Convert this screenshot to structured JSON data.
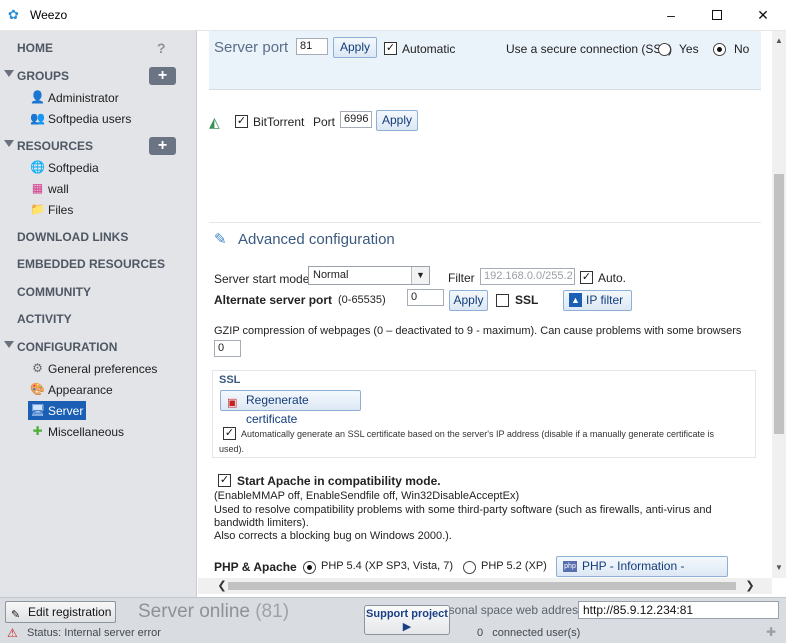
{
  "window": {
    "app_icon": "weezo-logo",
    "title": "Weezo",
    "min_glyph": "–",
    "close_glyph": "✕"
  },
  "sidebar": {
    "home": "HOME",
    "help_glyph": "?",
    "groups": {
      "label": "GROUPS",
      "add_glyph": "+",
      "items": [
        {
          "label": "Administrator",
          "icon": "admin-user-icon"
        },
        {
          "label": "Softpedia users",
          "icon": "user-group-icon"
        }
      ]
    },
    "resources": {
      "label": "RESOURCES",
      "add_glyph": "+",
      "items": [
        {
          "label": "Softpedia",
          "icon": "web-resource-icon"
        },
        {
          "label": "wall",
          "icon": "wall-icon"
        },
        {
          "label": "Files",
          "icon": "folder-icon"
        }
      ]
    },
    "download_links": "DOWNLOAD LINKS",
    "embedded_resources": "EMBEDDED RESOURCES",
    "community": "COMMUNITY",
    "activity": "ACTIVITY",
    "configuration": {
      "label": "CONFIGURATION",
      "items": [
        {
          "label": "General preferences",
          "icon": "preferences-icon"
        },
        {
          "label": "Appearance",
          "icon": "palette-icon"
        },
        {
          "label": "Server",
          "icon": "monitor-icon",
          "selected": true
        },
        {
          "label": "Miscellaneous",
          "icon": "puzzle-icon"
        }
      ]
    }
  },
  "server": {
    "port_label": "Server port",
    "port_value": "81",
    "apply": "Apply",
    "automatic_label": "Automatic",
    "automatic_checked": true,
    "ssl_question": "Use a secure connection (SSL)",
    "yes": "Yes",
    "no": "No",
    "ssl_selected": "No"
  },
  "bittorrent": {
    "label": "BitTorrent",
    "checked": true,
    "port_label": "Port",
    "port_value": "6996",
    "apply": "Apply"
  },
  "advanced": {
    "title": "Advanced configuration",
    "start_mode_label": "Server start mode",
    "start_mode_value": "Normal",
    "filter_label": "Filter",
    "filter_value": "192.168.0.0/255.2",
    "auto_label": "Auto.",
    "auto_checked": true,
    "alt_port_label": "Alternate server port",
    "alt_port_range": "(0-65535)",
    "alt_port_value": "0",
    "apply": "Apply",
    "ssl_label": "SSL",
    "ssl_checked": false,
    "ip_filter": "IP filter",
    "gzip_label": "GZIP compression of webpages (0 – deactivated to 9 - maximum). Can cause problems with some browsers",
    "gzip_value": "0"
  },
  "ssl_section": {
    "title": "SSL",
    "regen_button": "Regenerate certificate",
    "auto_gen_line1": "Automatically generate an SSL certificate based on the server's IP address (disable if a manually generate certificate is",
    "auto_gen_line2": "used).",
    "auto_gen_checked": true
  },
  "apache": {
    "label": "Start Apache in compatibility mode.",
    "checked": true,
    "line1": "(EnableMMAP off, EnableSendfile off, Win32DisableAcceptEx)",
    "line2": "Used to resolve compatibility problems with some third-party software (such as firewalls, anti-virus and",
    "line3": "bandwidth limiters).",
    "line4": "Also corrects a blocking bug on Windows 2000.)."
  },
  "php": {
    "label": "PHP & Apache",
    "option1": "PHP 5.4 (XP SP3, Vista, 7)",
    "option2": "PHP 5.2 (XP)",
    "selected": "PHP 5.4 (XP SP3, Vista, 7)",
    "info_button": "PHP - Information - phpinfo()"
  },
  "bottom": {
    "edit_registration": "Edit registration",
    "server_online": "Server online",
    "online_count": "(81)",
    "support_project": "Support project",
    "web_address_label": "Personal space web address",
    "web_address_value": "http://85.9.12.234:81",
    "status": "Status: Internal server error",
    "connected_count": "0",
    "connected_label": "connected user(s)"
  }
}
